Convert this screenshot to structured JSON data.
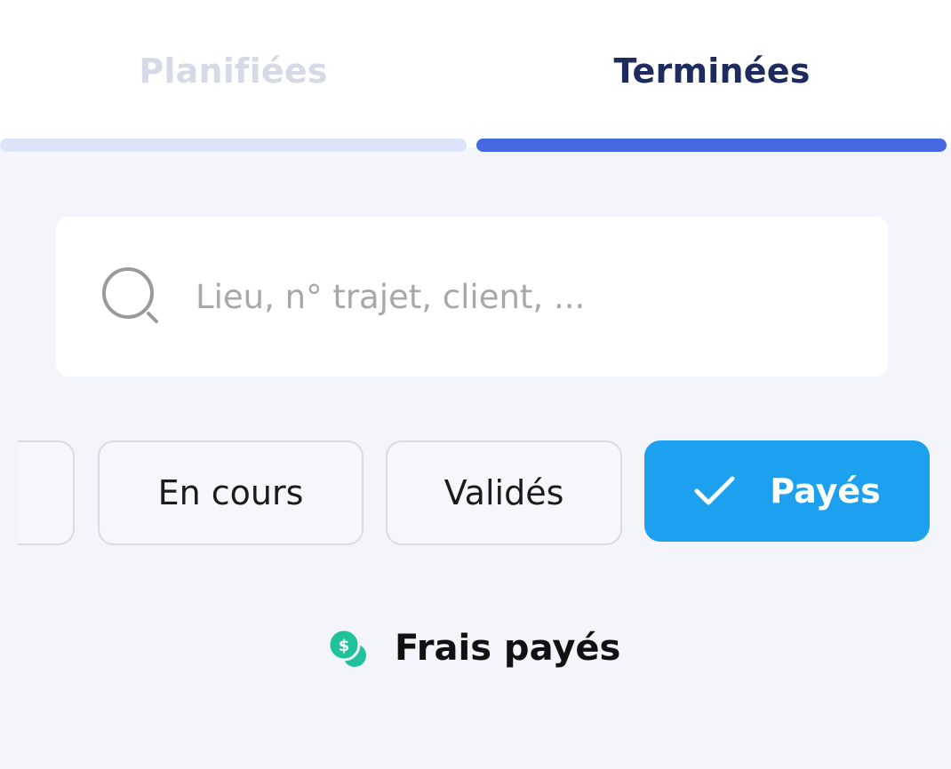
{
  "tabs": {
    "planned": {
      "label": "Planifiées",
      "active": false
    },
    "done": {
      "label": "Terminées",
      "active": true
    }
  },
  "colors": {
    "accent": "#4669e2",
    "tab_active_text": "#1d2b5e",
    "tab_inactive_text": "#d6d9e6",
    "chip_selected": "#1da1ee",
    "legend_icon": "#1fc29a"
  },
  "search": {
    "placeholder": "Lieu, n° trajet, client, ...",
    "value": "",
    "icon": "search-icon"
  },
  "filters": [
    {
      "label": "",
      "selected": false
    },
    {
      "label": "En cours",
      "selected": false
    },
    {
      "label": "Validés",
      "selected": false
    },
    {
      "label": "Payés",
      "selected": true,
      "icon": "check-icon"
    }
  ],
  "legend": {
    "icon": "money-coin-icon",
    "label": "Frais payés"
  }
}
